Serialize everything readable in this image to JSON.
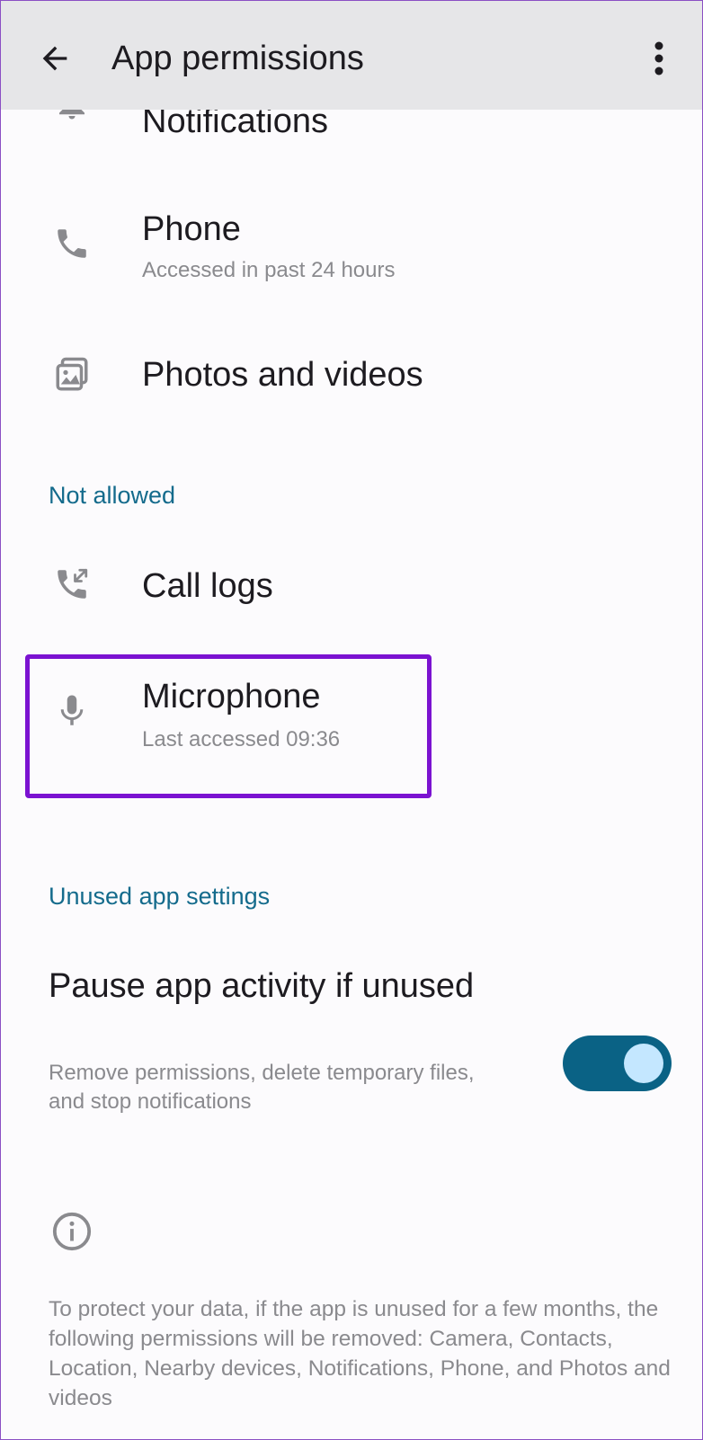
{
  "appbar": {
    "title": "App permissions",
    "back_icon": "arrow-left-icon",
    "overflow_icon": "more-vert-icon"
  },
  "allowed_items": [
    {
      "title": "Notifications",
      "subtitle": "",
      "icon": "bell-icon"
    },
    {
      "title": "Phone",
      "subtitle": "Accessed in past 24 hours",
      "icon": "phone-icon"
    },
    {
      "title": "Photos and videos",
      "subtitle": "",
      "icon": "photos-icon"
    }
  ],
  "not_allowed": {
    "header": "Not allowed",
    "items": [
      {
        "title": "Call logs",
        "subtitle": "",
        "icon": "call-log-icon"
      },
      {
        "title": "Microphone",
        "subtitle": "Last accessed 09:36",
        "icon": "microphone-icon"
      }
    ]
  },
  "unused": {
    "header": "Unused app settings",
    "pause_title": "Pause app activity if unused",
    "pause_subtitle": "Remove permissions, delete temporary files, and stop notifications",
    "pause_enabled": true,
    "info_icon": "info-icon",
    "info_text": "To protect your data, if the app is unused for a few months, the following permissions will be removed: Camera, Contacts, Location, Nearby devices, Notifications, Phone, and Photos and videos"
  },
  "colors": {
    "appbar_bg": "#e6e6e8",
    "accent": "#146b8c",
    "switch_track": "#0a6285",
    "switch_thumb": "#c4e7ff",
    "highlight": "#7b12d1",
    "icon": "#8a8a8e"
  }
}
